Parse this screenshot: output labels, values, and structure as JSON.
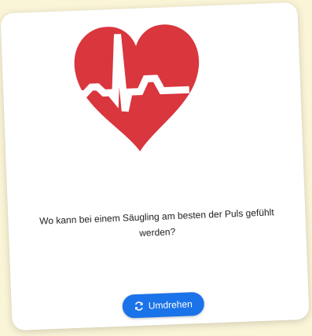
{
  "card": {
    "question": "Wo kann bei einem Säugling am besten der Puls gefühlt werden?",
    "illustration_icon": "heart-ecg-icon",
    "flip_button": {
      "label": "Umdrehen",
      "icon": "refresh-icon"
    }
  },
  "colors": {
    "background": "#fbf5d8",
    "card": "#ffffff",
    "heart": "#d9363e",
    "button": "#1a73e8",
    "button_text": "#ffffff"
  }
}
